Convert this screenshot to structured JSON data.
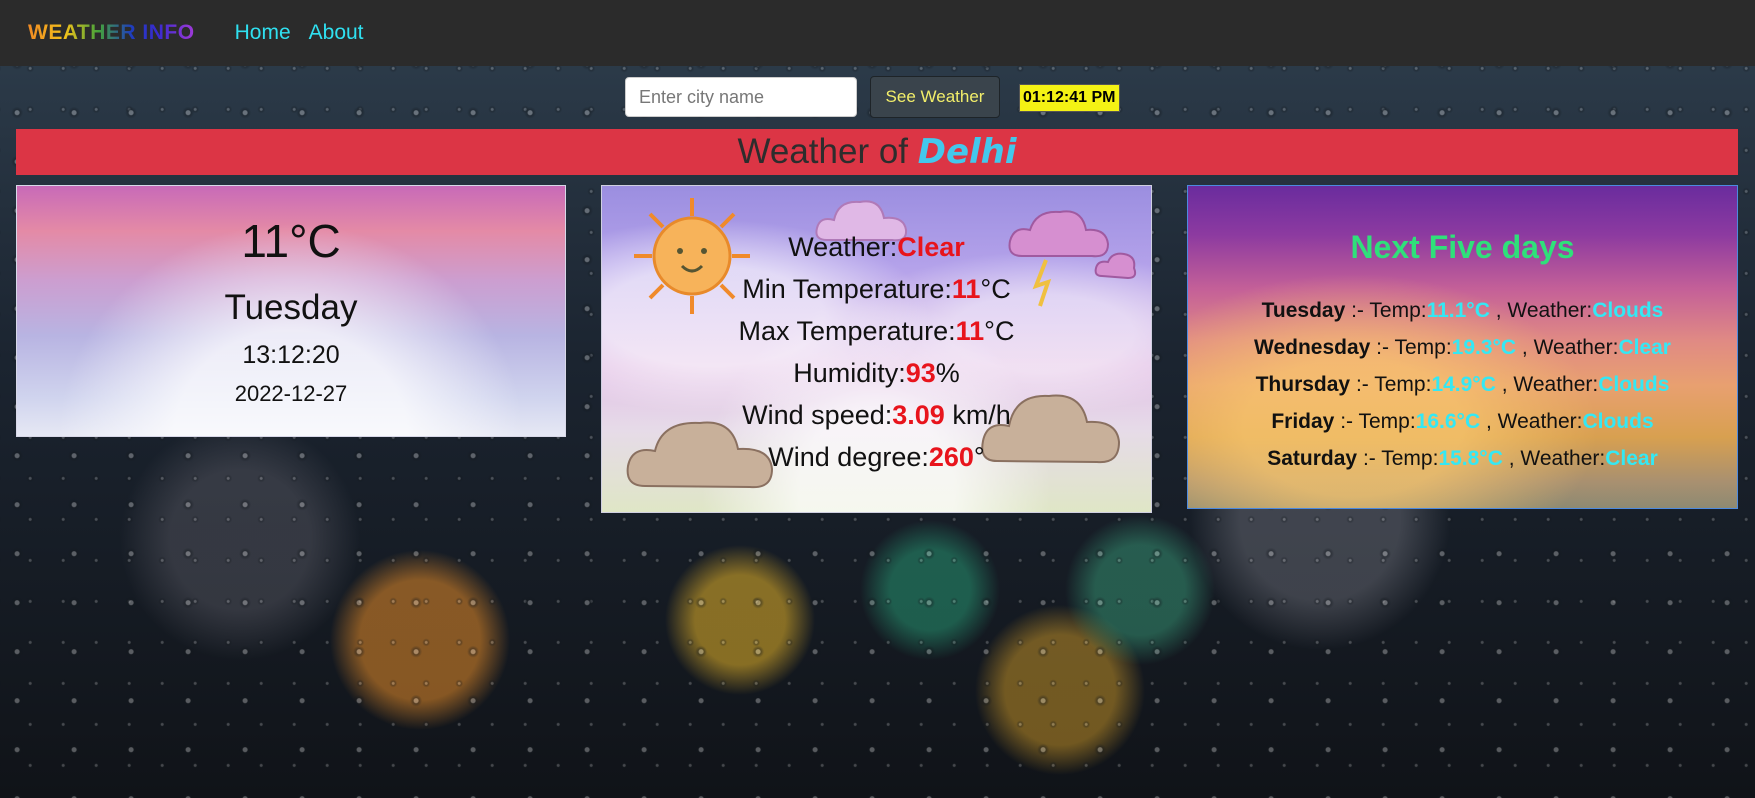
{
  "navbar": {
    "brand": "WEATHER INFO",
    "links": [
      {
        "label": "Home"
      },
      {
        "label": "About"
      }
    ]
  },
  "search": {
    "placeholder": "Enter city name",
    "value": "",
    "button_label": "See Weather",
    "clock": "01:12:41 PM"
  },
  "banner": {
    "prefix": "Weather of ",
    "city": "Delhi"
  },
  "today": {
    "temp": "11°C",
    "day": "Tuesday",
    "time": "13:12:20",
    "date": "2022-12-27"
  },
  "current": {
    "rows": [
      {
        "label": "Weather:",
        "value": "Clear",
        "unit": ""
      },
      {
        "label": "Min Temperature:",
        "value": "11",
        "unit": "°C"
      },
      {
        "label": "Max Temperature:",
        "value": "11",
        "unit": "°C"
      },
      {
        "label": "Humidity:",
        "value": "93",
        "unit": "%"
      },
      {
        "label": "Wind speed:",
        "value": "3.09",
        "unit": " km/h"
      },
      {
        "label": "Wind degree:",
        "value": "260",
        "unit": "°"
      }
    ]
  },
  "forecast": {
    "title": "Next Five days",
    "temp_label": "Temp:",
    "weather_label": "Weather:",
    "separator": " :- ",
    "days": [
      {
        "day": "Tuesday",
        "temp": "11.1°C",
        "weather": "Clouds"
      },
      {
        "day": "Wednesday",
        "temp": "19.3°C",
        "weather": "Clear"
      },
      {
        "day": "Thursday",
        "temp": "14.9°C",
        "weather": "Clouds"
      },
      {
        "day": "Friday",
        "temp": "16.6°C",
        "weather": "Clouds"
      },
      {
        "day": "Saturday",
        "temp": "15.8°C",
        "weather": "Clear"
      }
    ]
  },
  "colors": {
    "navbar_bg": "#2b2b2b",
    "nav_link": "#2fe0f0",
    "banner_bg": "#dc3545",
    "city": "#43c8ec",
    "clock_bg": "#f4f214",
    "value_red": "#e8141c",
    "forecast_title": "#2fe07a",
    "forecast_value": "#34e8f4"
  }
}
